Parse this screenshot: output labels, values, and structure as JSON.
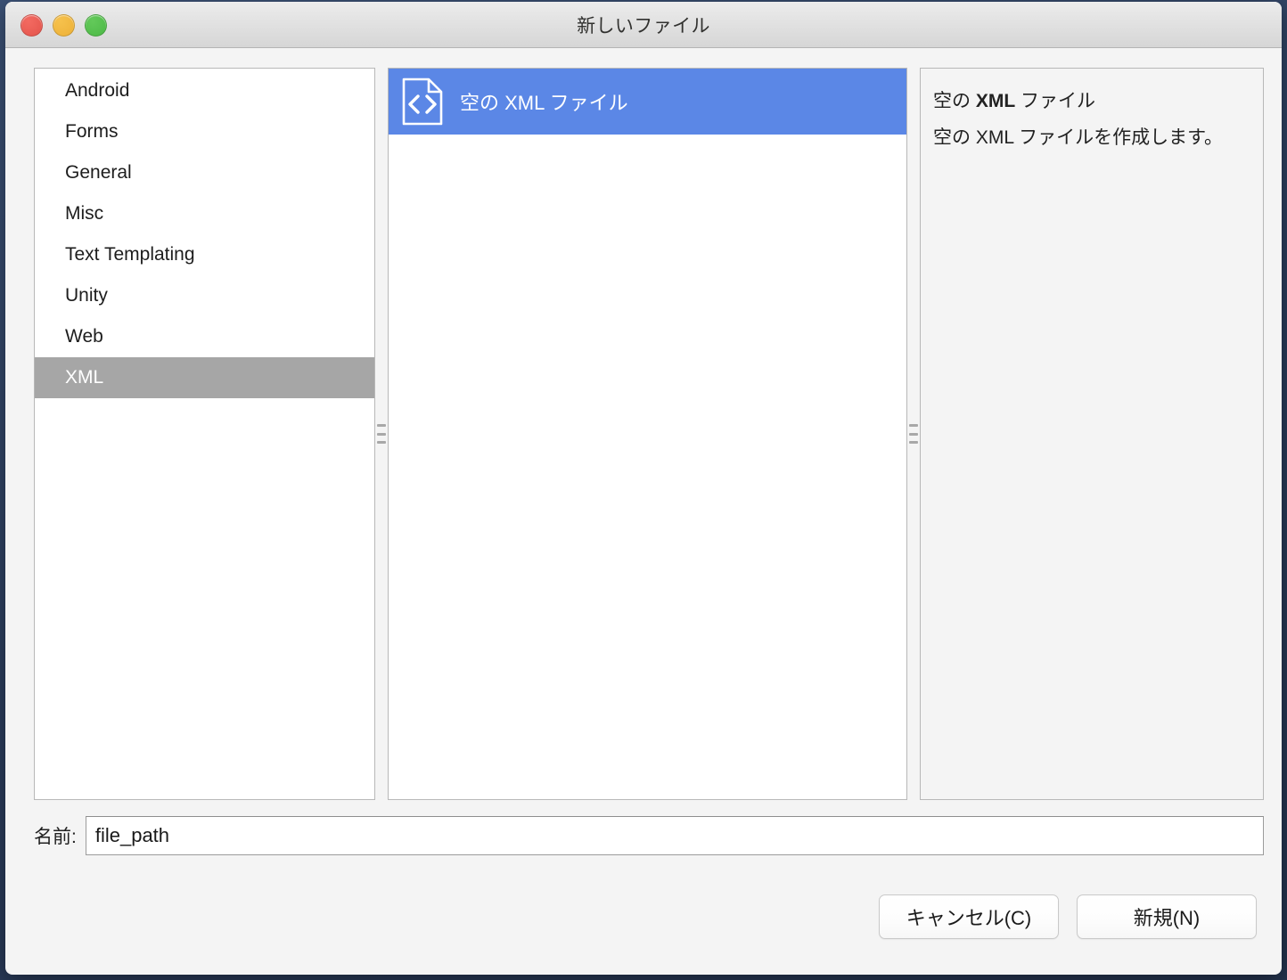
{
  "window": {
    "title": "新しいファイル",
    "traffic_lights": [
      {
        "name": "close",
        "color": "#e4544c"
      },
      {
        "name": "minimize",
        "color": "#edb138"
      },
      {
        "name": "zoom",
        "color": "#4cb946"
      }
    ]
  },
  "categories": {
    "items": [
      {
        "label": "Android",
        "selected": false
      },
      {
        "label": "Forms",
        "selected": false
      },
      {
        "label": "General",
        "selected": false
      },
      {
        "label": "Misc",
        "selected": false
      },
      {
        "label": "Text Templating",
        "selected": false
      },
      {
        "label": "Unity",
        "selected": false
      },
      {
        "label": "Web",
        "selected": false
      },
      {
        "label": "XML",
        "selected": true
      }
    ],
    "selected_label": "XML",
    "selected_bg": "#a6a6a6"
  },
  "templates": {
    "items": [
      {
        "label": "空の XML ファイル",
        "icon": "xml-file-icon",
        "selected": true
      }
    ],
    "selected_bg": "#5b87e6"
  },
  "description": {
    "title_prefix": "空の ",
    "title_bold": "XML",
    "title_suffix": " ファイル",
    "body": "空の XML ファイルを作成します。"
  },
  "name_field": {
    "label": "名前:",
    "value": "file_path",
    "placeholder": ""
  },
  "footer": {
    "cancel_label": "キャンセル(C)",
    "create_label": "新規(N)"
  }
}
